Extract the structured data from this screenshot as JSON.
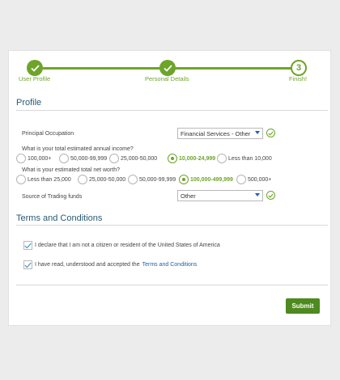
{
  "steps": [
    {
      "label": "User Profile",
      "state": "done"
    },
    {
      "label": "Personal Details",
      "state": "done"
    },
    {
      "label": "Finish!",
      "state": "current",
      "number": "3"
    }
  ],
  "profile": {
    "title": "Profile",
    "occupation": {
      "label": "Principal Occupation",
      "value": "Financial Services - Other"
    },
    "income": {
      "label": "What is your total estimated annual income?",
      "options": [
        "100,000+",
        "50,000-99,999",
        "25,000-50,000",
        "10,000-24,999",
        "Less than 10,000"
      ],
      "selected": "10,000-24,999"
    },
    "networth": {
      "label": "What is your estimated total net worth?",
      "options": [
        "Less than 25,000",
        "25,000-50,000",
        "50,000-99,999",
        "100,000-499,999",
        "500,000+"
      ],
      "selected": "100,000-499,999"
    },
    "funds": {
      "label": "Source of Trading funds",
      "value": "Other"
    }
  },
  "terms": {
    "title": "Terms and Conditions",
    "declaration": "I declare that I am not a citizen or resident of the United States of America",
    "accept_prefix": "I have read, understood and accepted the",
    "accept_link": "Terms and Conditions"
  },
  "submit_label": "Submit",
  "colors": {
    "accent": "#6ea42a",
    "heading": "#2a5a73",
    "link": "#1f5ea8",
    "button": "#4e8a1f"
  }
}
